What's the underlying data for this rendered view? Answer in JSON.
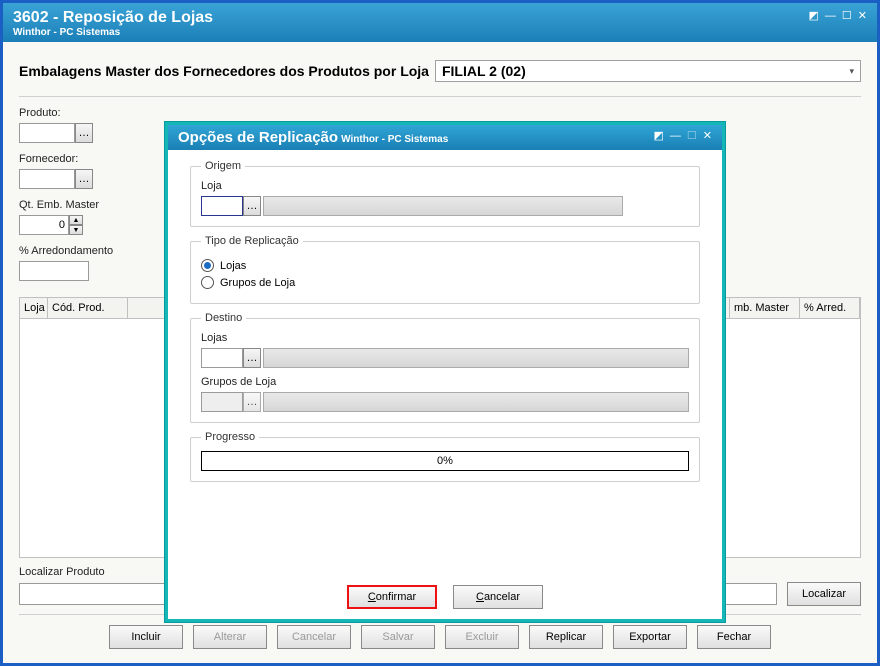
{
  "main": {
    "title": "3602 - Reposição de Lojas",
    "subtitle": "Winthor - PC Sistemas",
    "header_label": "Embalagens Master dos Fornecedores dos Produtos por Loja",
    "loja_select_value": "FILIAL 2 (02)",
    "filters": {
      "produto_label": "Produto:",
      "fornecedor_label": "Fornecedor:",
      "qt_emb_label": "Qt. Emb. Master",
      "qt_emb_value": "0",
      "arred_label": "% Arredondamento"
    },
    "grid_headers": {
      "loja": "Loja",
      "cod_prod": "Cód. Prod.",
      "emb_master": "mb. Master",
      "arred": "% Arred."
    },
    "localizar_label": "Localizar Produto",
    "buttons": {
      "incluir": "Incluir",
      "alterar": "Alterar",
      "cancelar": "Cancelar",
      "salvar": "Salvar",
      "excluir": "Excluir",
      "replicar": "Replicar",
      "exportar": "Exportar",
      "fechar": "Fechar",
      "localizar": "Localizar"
    }
  },
  "modal": {
    "title": "Opções de Replicação",
    "subtitle": "Winthor - PC Sistemas",
    "origem": {
      "legend": "Origem",
      "loja_label": "Loja"
    },
    "tipo": {
      "legend": "Tipo de Replicação",
      "opt_lojas": "Lojas",
      "opt_grupos": "Grupos de Loja"
    },
    "destino": {
      "legend": "Destino",
      "lojas_label": "Lojas",
      "grupos_label": "Grupos de Loja"
    },
    "progresso": {
      "legend": "Progresso",
      "value": "0%"
    },
    "buttons": {
      "confirmar": "Confirmar",
      "cancelar": "Cancelar"
    }
  }
}
